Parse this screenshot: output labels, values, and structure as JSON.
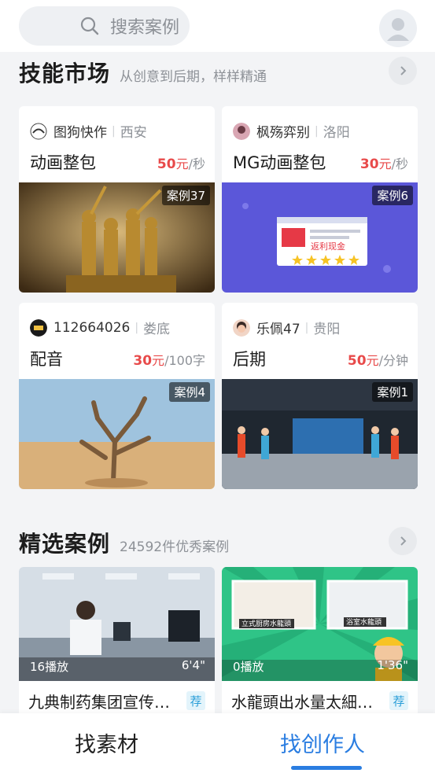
{
  "search": {
    "placeholder": "搜索案例"
  },
  "skills": {
    "title": "技能市场",
    "subtitle": "从创意到后期，样样精通",
    "cards": [
      {
        "seller": "图狗快作",
        "city": "西安",
        "service": "动画整包",
        "price": "50",
        "currency": "元",
        "unit": "/秒",
        "cases": "案例37"
      },
      {
        "seller": "枫殇弈别",
        "city": "洛阳",
        "service": "MG动画整包",
        "price": "30",
        "currency": "元",
        "unit": "/秒",
        "cases": "案例6"
      },
      {
        "seller": "112664026",
        "city": "娄底",
        "service": "配音",
        "price": "30",
        "currency": "元",
        "unit": "/100字",
        "cases": "案例4"
      },
      {
        "seller": "乐佩47",
        "city": "贵阳",
        "service": "后期",
        "price": "50",
        "currency": "元",
        "unit": "/分钟",
        "cases": "案例1"
      }
    ]
  },
  "featured": {
    "title": "精选案例",
    "subtitle": "24592件优秀案例",
    "items": [
      {
        "plays": "16播放",
        "duration": "6'4\"",
        "title": "九典制药集团宣传…",
        "tag": "荐"
      },
      {
        "plays": "0播放",
        "duration": "1'36\"",
        "title": "水龍頭出水量太細…",
        "tag": "荐"
      }
    ]
  },
  "thumb_text": {
    "promo": "返利现金",
    "kitchen": "立式厨房水龍頭",
    "bath": "浴室水龍頭"
  },
  "tabs": {
    "materials": "找素材",
    "creators": "找创作人"
  },
  "colors": {
    "accent": "#2a7de1",
    "price": "#e84a4a"
  }
}
